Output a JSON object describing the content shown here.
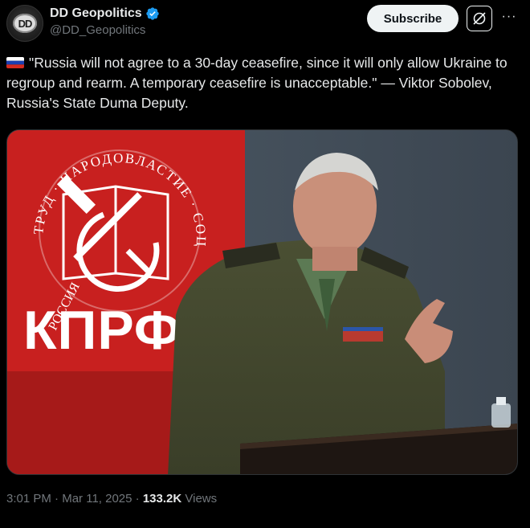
{
  "author": {
    "display_name": "DD Geopolitics",
    "handle": "@DD_Geopolitics",
    "avatar_text": "DD",
    "verified": true
  },
  "actions": {
    "subscribe_label": "Subscribe",
    "more_label": "···"
  },
  "tweet": {
    "text": "\"Russia will not agree to a 30-day ceasefire, since it will only allow Ukraine to regroup and rearm. A temporary ceasefire is unacceptable.\" — Viktor Sobolev, Russia's State Duma Deputy.",
    "flag": "russia-flag"
  },
  "media": {
    "banner_top_text": "ТРУД · НАРОДОВЛАСТИЕ · СОЦИАЛИЗМ",
    "banner_side_text": "РОССИЯ",
    "banner_main_text": "КПРФ"
  },
  "meta": {
    "time": "3:01 PM",
    "separator": "·",
    "date": "Mar 11, 2025",
    "views_count": "133.2K",
    "views_label": "Views"
  },
  "colors": {
    "background": "#000000",
    "text": "#e7e9ea",
    "muted": "#71767b",
    "verified": "#1d9bf0",
    "banner_red": "#c8201f"
  }
}
